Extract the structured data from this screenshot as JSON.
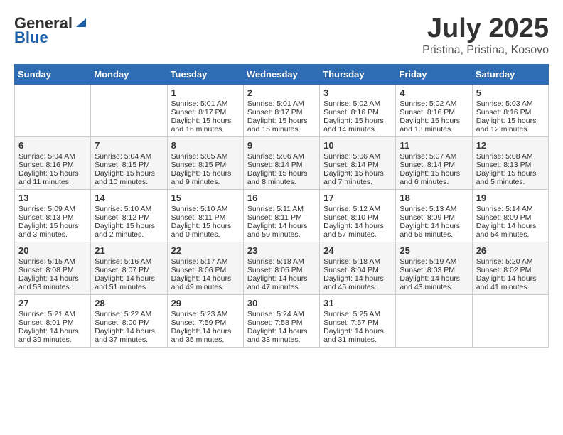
{
  "header": {
    "logo_general": "General",
    "logo_blue": "Blue",
    "month": "July 2025",
    "location": "Pristina, Pristina, Kosovo"
  },
  "weekdays": [
    "Sunday",
    "Monday",
    "Tuesday",
    "Wednesday",
    "Thursday",
    "Friday",
    "Saturday"
  ],
  "weeks": [
    [
      {
        "day": "",
        "sunrise": "",
        "sunset": "",
        "daylight": ""
      },
      {
        "day": "",
        "sunrise": "",
        "sunset": "",
        "daylight": ""
      },
      {
        "day": "1",
        "sunrise": "Sunrise: 5:01 AM",
        "sunset": "Sunset: 8:17 PM",
        "daylight": "Daylight: 15 hours and 16 minutes."
      },
      {
        "day": "2",
        "sunrise": "Sunrise: 5:01 AM",
        "sunset": "Sunset: 8:17 PM",
        "daylight": "Daylight: 15 hours and 15 minutes."
      },
      {
        "day": "3",
        "sunrise": "Sunrise: 5:02 AM",
        "sunset": "Sunset: 8:16 PM",
        "daylight": "Daylight: 15 hours and 14 minutes."
      },
      {
        "day": "4",
        "sunrise": "Sunrise: 5:02 AM",
        "sunset": "Sunset: 8:16 PM",
        "daylight": "Daylight: 15 hours and 13 minutes."
      },
      {
        "day": "5",
        "sunrise": "Sunrise: 5:03 AM",
        "sunset": "Sunset: 8:16 PM",
        "daylight": "Daylight: 15 hours and 12 minutes."
      }
    ],
    [
      {
        "day": "6",
        "sunrise": "Sunrise: 5:04 AM",
        "sunset": "Sunset: 8:16 PM",
        "daylight": "Daylight: 15 hours and 11 minutes."
      },
      {
        "day": "7",
        "sunrise": "Sunrise: 5:04 AM",
        "sunset": "Sunset: 8:15 PM",
        "daylight": "Daylight: 15 hours and 10 minutes."
      },
      {
        "day": "8",
        "sunrise": "Sunrise: 5:05 AM",
        "sunset": "Sunset: 8:15 PM",
        "daylight": "Daylight: 15 hours and 9 minutes."
      },
      {
        "day": "9",
        "sunrise": "Sunrise: 5:06 AM",
        "sunset": "Sunset: 8:14 PM",
        "daylight": "Daylight: 15 hours and 8 minutes."
      },
      {
        "day": "10",
        "sunrise": "Sunrise: 5:06 AM",
        "sunset": "Sunset: 8:14 PM",
        "daylight": "Daylight: 15 hours and 7 minutes."
      },
      {
        "day": "11",
        "sunrise": "Sunrise: 5:07 AM",
        "sunset": "Sunset: 8:14 PM",
        "daylight": "Daylight: 15 hours and 6 minutes."
      },
      {
        "day": "12",
        "sunrise": "Sunrise: 5:08 AM",
        "sunset": "Sunset: 8:13 PM",
        "daylight": "Daylight: 15 hours and 5 minutes."
      }
    ],
    [
      {
        "day": "13",
        "sunrise": "Sunrise: 5:09 AM",
        "sunset": "Sunset: 8:13 PM",
        "daylight": "Daylight: 15 hours and 3 minutes."
      },
      {
        "day": "14",
        "sunrise": "Sunrise: 5:10 AM",
        "sunset": "Sunset: 8:12 PM",
        "daylight": "Daylight: 15 hours and 2 minutes."
      },
      {
        "day": "15",
        "sunrise": "Sunrise: 5:10 AM",
        "sunset": "Sunset: 8:11 PM",
        "daylight": "Daylight: 15 hours and 0 minutes."
      },
      {
        "day": "16",
        "sunrise": "Sunrise: 5:11 AM",
        "sunset": "Sunset: 8:11 PM",
        "daylight": "Daylight: 14 hours and 59 minutes."
      },
      {
        "day": "17",
        "sunrise": "Sunrise: 5:12 AM",
        "sunset": "Sunset: 8:10 PM",
        "daylight": "Daylight: 14 hours and 57 minutes."
      },
      {
        "day": "18",
        "sunrise": "Sunrise: 5:13 AM",
        "sunset": "Sunset: 8:09 PM",
        "daylight": "Daylight: 14 hours and 56 minutes."
      },
      {
        "day": "19",
        "sunrise": "Sunrise: 5:14 AM",
        "sunset": "Sunset: 8:09 PM",
        "daylight": "Daylight: 14 hours and 54 minutes."
      }
    ],
    [
      {
        "day": "20",
        "sunrise": "Sunrise: 5:15 AM",
        "sunset": "Sunset: 8:08 PM",
        "daylight": "Daylight: 14 hours and 53 minutes."
      },
      {
        "day": "21",
        "sunrise": "Sunrise: 5:16 AM",
        "sunset": "Sunset: 8:07 PM",
        "daylight": "Daylight: 14 hours and 51 minutes."
      },
      {
        "day": "22",
        "sunrise": "Sunrise: 5:17 AM",
        "sunset": "Sunset: 8:06 PM",
        "daylight": "Daylight: 14 hours and 49 minutes."
      },
      {
        "day": "23",
        "sunrise": "Sunrise: 5:18 AM",
        "sunset": "Sunset: 8:05 PM",
        "daylight": "Daylight: 14 hours and 47 minutes."
      },
      {
        "day": "24",
        "sunrise": "Sunrise: 5:18 AM",
        "sunset": "Sunset: 8:04 PM",
        "daylight": "Daylight: 14 hours and 45 minutes."
      },
      {
        "day": "25",
        "sunrise": "Sunrise: 5:19 AM",
        "sunset": "Sunset: 8:03 PM",
        "daylight": "Daylight: 14 hours and 43 minutes."
      },
      {
        "day": "26",
        "sunrise": "Sunrise: 5:20 AM",
        "sunset": "Sunset: 8:02 PM",
        "daylight": "Daylight: 14 hours and 41 minutes."
      }
    ],
    [
      {
        "day": "27",
        "sunrise": "Sunrise: 5:21 AM",
        "sunset": "Sunset: 8:01 PM",
        "daylight": "Daylight: 14 hours and 39 minutes."
      },
      {
        "day": "28",
        "sunrise": "Sunrise: 5:22 AM",
        "sunset": "Sunset: 8:00 PM",
        "daylight": "Daylight: 14 hours and 37 minutes."
      },
      {
        "day": "29",
        "sunrise": "Sunrise: 5:23 AM",
        "sunset": "Sunset: 7:59 PM",
        "daylight": "Daylight: 14 hours and 35 minutes."
      },
      {
        "day": "30",
        "sunrise": "Sunrise: 5:24 AM",
        "sunset": "Sunset: 7:58 PM",
        "daylight": "Daylight: 14 hours and 33 minutes."
      },
      {
        "day": "31",
        "sunrise": "Sunrise: 5:25 AM",
        "sunset": "Sunset: 7:57 PM",
        "daylight": "Daylight: 14 hours and 31 minutes."
      },
      {
        "day": "",
        "sunrise": "",
        "sunset": "",
        "daylight": ""
      },
      {
        "day": "",
        "sunrise": "",
        "sunset": "",
        "daylight": ""
      }
    ]
  ]
}
